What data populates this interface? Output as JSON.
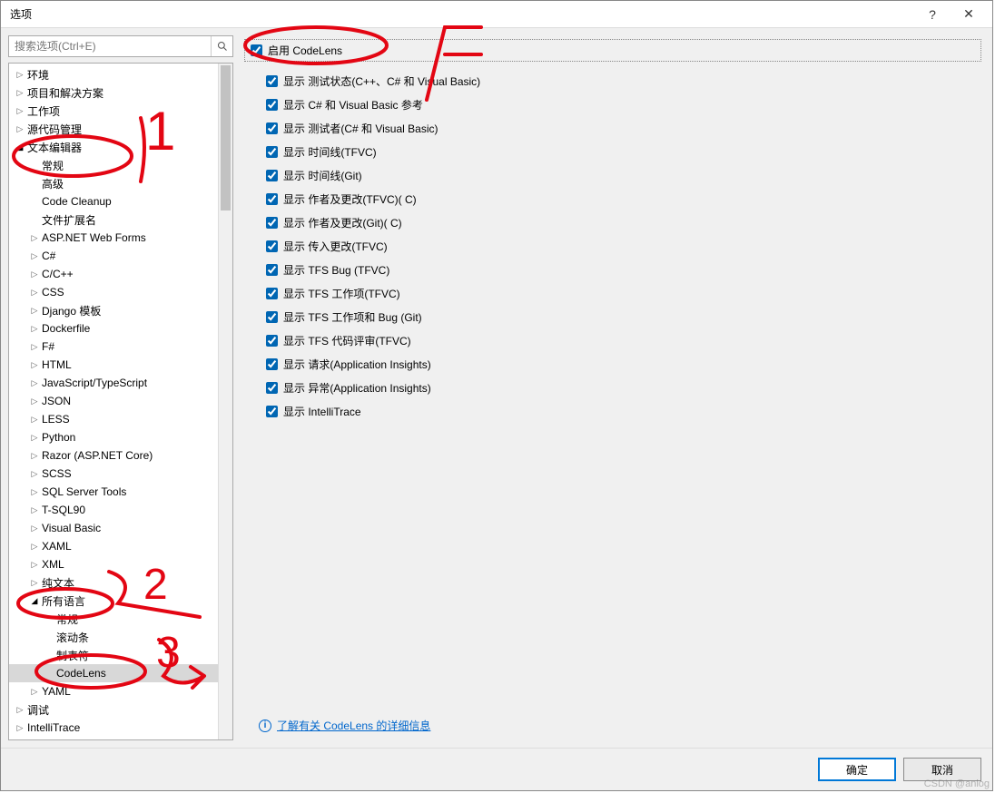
{
  "window": {
    "title": "选项",
    "help": "?",
    "close": "✕"
  },
  "search": {
    "placeholder": "搜索选项(Ctrl+E)"
  },
  "tree": [
    {
      "depth": 0,
      "expand": "closed",
      "label": "环境"
    },
    {
      "depth": 0,
      "expand": "closed",
      "label": "项目和解决方案"
    },
    {
      "depth": 0,
      "expand": "closed",
      "label": "工作项"
    },
    {
      "depth": 0,
      "expand": "closed",
      "label": "源代码管理"
    },
    {
      "depth": 0,
      "expand": "open",
      "label": "文本编辑器"
    },
    {
      "depth": 1,
      "expand": "none",
      "label": "常规"
    },
    {
      "depth": 1,
      "expand": "none",
      "label": "高级"
    },
    {
      "depth": 1,
      "expand": "none",
      "label": "Code Cleanup"
    },
    {
      "depth": 1,
      "expand": "none",
      "label": "文件扩展名"
    },
    {
      "depth": 1,
      "expand": "closed",
      "label": "ASP.NET Web Forms"
    },
    {
      "depth": 1,
      "expand": "closed",
      "label": "C#"
    },
    {
      "depth": 1,
      "expand": "closed",
      "label": "C/C++"
    },
    {
      "depth": 1,
      "expand": "closed",
      "label": "CSS"
    },
    {
      "depth": 1,
      "expand": "closed",
      "label": "Django 模板"
    },
    {
      "depth": 1,
      "expand": "closed",
      "label": "Dockerfile"
    },
    {
      "depth": 1,
      "expand": "closed",
      "label": "F#"
    },
    {
      "depth": 1,
      "expand": "closed",
      "label": "HTML"
    },
    {
      "depth": 1,
      "expand": "closed",
      "label": "JavaScript/TypeScript"
    },
    {
      "depth": 1,
      "expand": "closed",
      "label": "JSON"
    },
    {
      "depth": 1,
      "expand": "closed",
      "label": "LESS"
    },
    {
      "depth": 1,
      "expand": "closed",
      "label": "Python"
    },
    {
      "depth": 1,
      "expand": "closed",
      "label": "Razor (ASP.NET Core)"
    },
    {
      "depth": 1,
      "expand": "closed",
      "label": "SCSS"
    },
    {
      "depth": 1,
      "expand": "closed",
      "label": "SQL Server Tools"
    },
    {
      "depth": 1,
      "expand": "closed",
      "label": "T-SQL90"
    },
    {
      "depth": 1,
      "expand": "closed",
      "label": "Visual Basic"
    },
    {
      "depth": 1,
      "expand": "closed",
      "label": "XAML"
    },
    {
      "depth": 1,
      "expand": "closed",
      "label": "XML"
    },
    {
      "depth": 1,
      "expand": "closed",
      "label": "纯文本"
    },
    {
      "depth": 1,
      "expand": "open",
      "label": "所有语言"
    },
    {
      "depth": 2,
      "expand": "none",
      "label": "常规"
    },
    {
      "depth": 2,
      "expand": "none",
      "label": "滚动条"
    },
    {
      "depth": 2,
      "expand": "none",
      "label": "制表符"
    },
    {
      "depth": 2,
      "expand": "none",
      "label": "CodeLens",
      "selected": true
    },
    {
      "depth": 1,
      "expand": "closed",
      "label": "YAML"
    },
    {
      "depth": 0,
      "expand": "closed",
      "label": "调试"
    },
    {
      "depth": 0,
      "expand": "closed",
      "label": "IntelliTrace"
    }
  ],
  "main_option": {
    "label": "启用 CodeLens",
    "checked": true
  },
  "sub_options": [
    {
      "label": "显示 测试状态(C++、C# 和 Visual Basic)",
      "checked": true
    },
    {
      "label": "显示 C# 和 Visual Basic 参考",
      "checked": true
    },
    {
      "label": "显示 测试者(C# 和 Visual Basic)",
      "checked": true
    },
    {
      "label": "显示 时间线(TFVC)",
      "checked": true
    },
    {
      "label": "显示 时间线(Git)",
      "checked": true
    },
    {
      "label": "显示 作者及更改(TFVC)( C)",
      "checked": true
    },
    {
      "label": "显示 作者及更改(Git)( C)",
      "checked": true
    },
    {
      "label": "显示 传入更改(TFVC)",
      "checked": true
    },
    {
      "label": "显示 TFS Bug (TFVC)",
      "checked": true
    },
    {
      "label": "显示 TFS 工作项(TFVC)",
      "checked": true
    },
    {
      "label": "显示 TFS 工作项和 Bug (Git)",
      "checked": true
    },
    {
      "label": "显示 TFS 代码评审(TFVC)",
      "checked": true
    },
    {
      "label": "显示 请求(Application Insights)",
      "checked": true
    },
    {
      "label": "显示 异常(Application Insights)",
      "checked": true
    },
    {
      "label": "显示 IntelliTrace",
      "checked": true
    }
  ],
  "link": {
    "text": "了解有关 CodeLens 的详细信息"
  },
  "buttons": {
    "ok": "确定",
    "cancel": "取消"
  },
  "watermark": "CSDN @anlog",
  "annotations": {
    "1": "1",
    "2": "2",
    "3": "3",
    "4": "4"
  }
}
